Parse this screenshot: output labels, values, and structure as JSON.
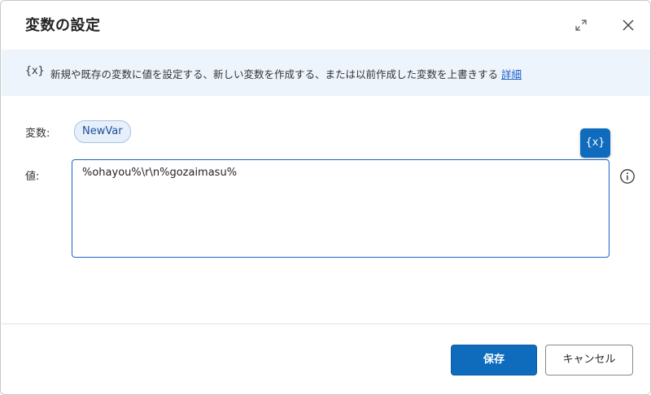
{
  "dialog": {
    "title": "変数の設定"
  },
  "info": {
    "icon_text": "{x}",
    "text": "新規や既存の変数に値を設定する、新しい変数を作成する、または以前作成した変数を上書きする",
    "link_label": "詳細"
  },
  "form": {
    "variable_label": "変数:",
    "variable_name": "NewVar",
    "value_label": "値:",
    "value": "%ohayou%\\r\\n%gozaimasu%",
    "insert_variable_icon": "{x}"
  },
  "footer": {
    "save_label": "保存",
    "cancel_label": "キャンセル"
  },
  "colors": {
    "accent": "#0f6cbd",
    "info_background": "#eef4fc",
    "chip_background": "#e6effa",
    "link": "#1a5fc9"
  },
  "icons": {
    "expand": "expand-icon",
    "close": "close-icon",
    "help": "info-circle-icon"
  }
}
